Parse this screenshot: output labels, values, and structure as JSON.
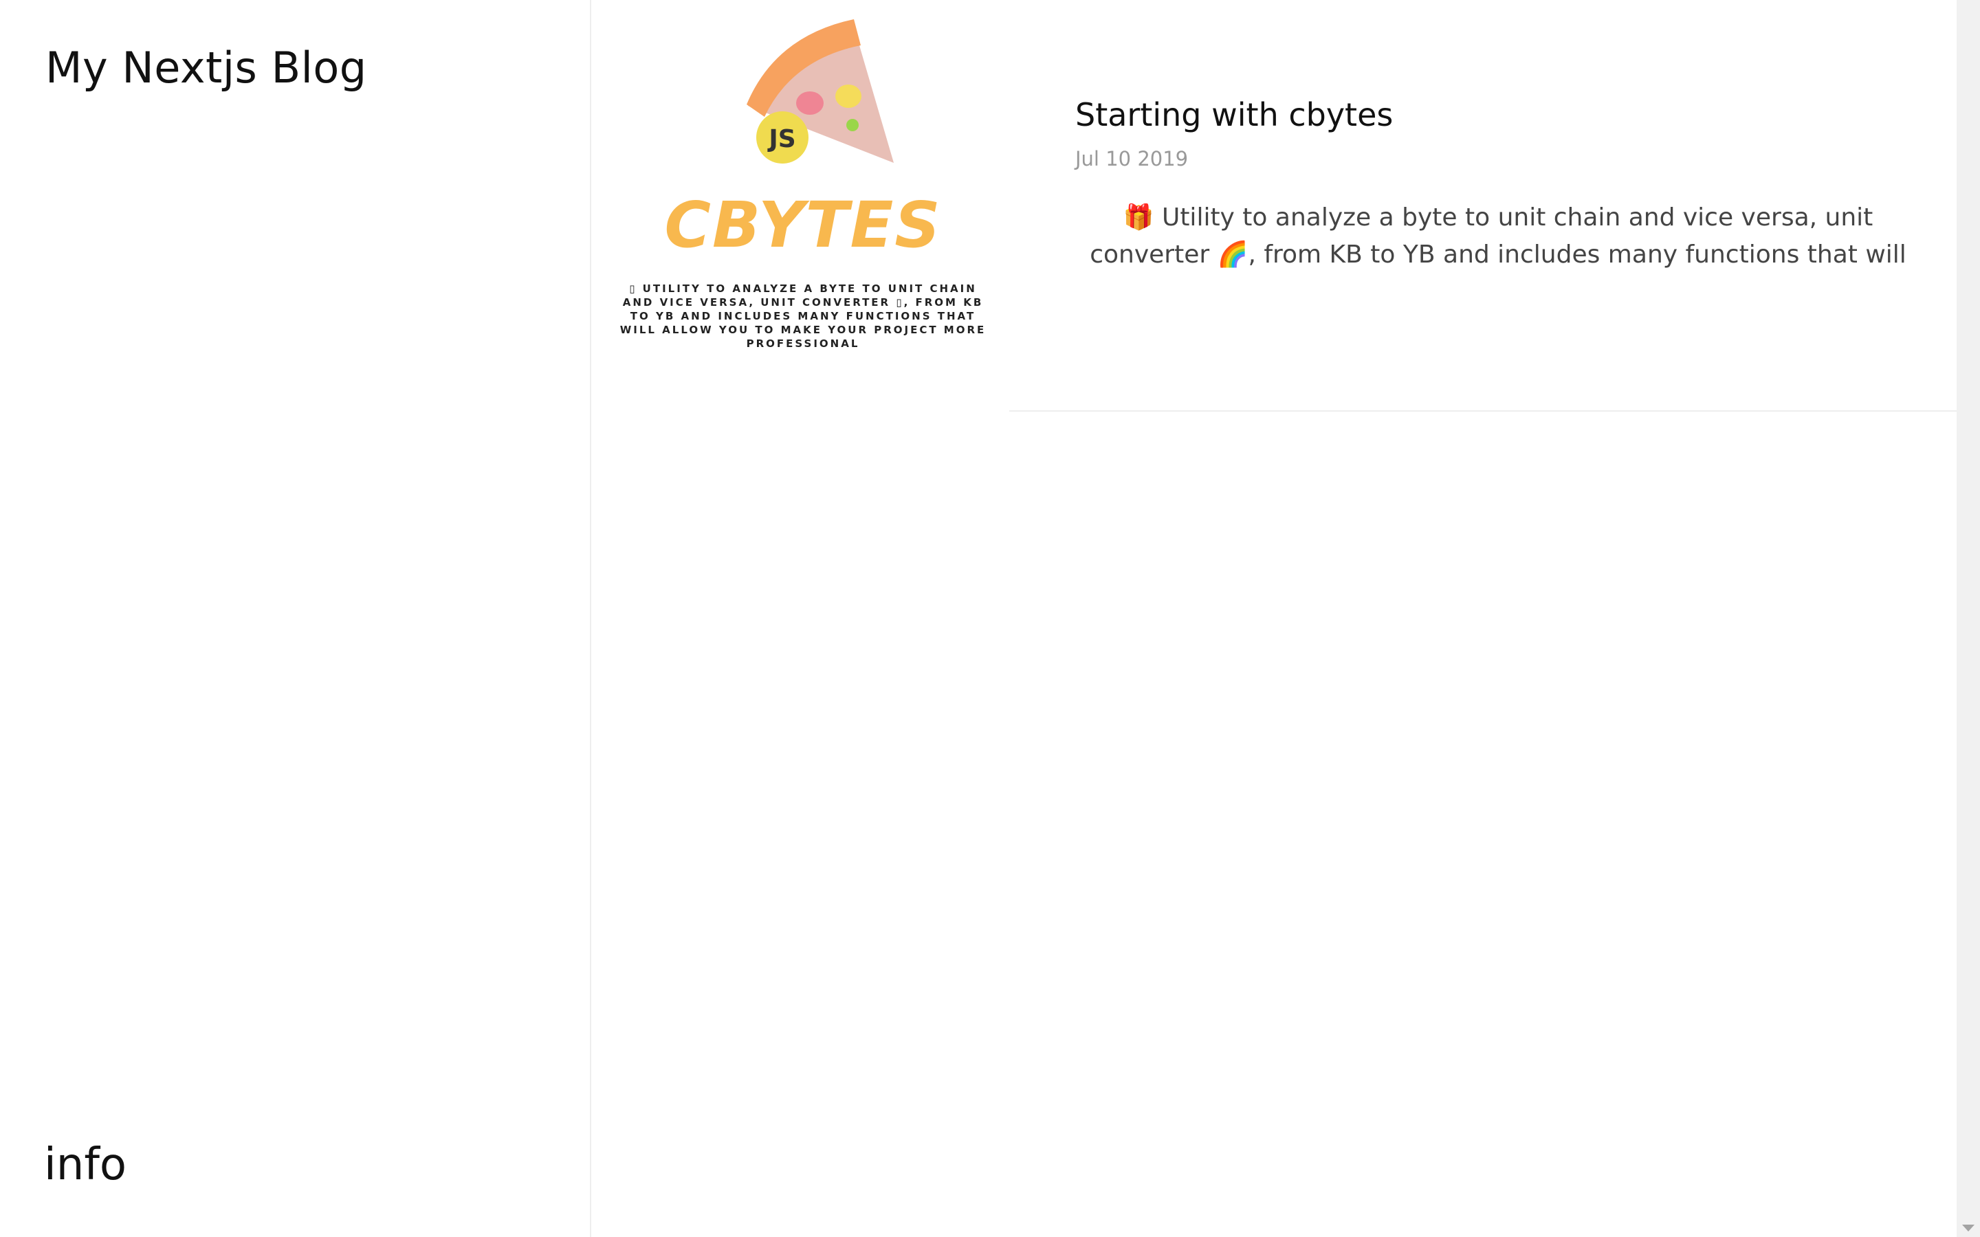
{
  "sidebar": {
    "title": "My Nextjs Blog",
    "info_link": "info"
  },
  "posts": [
    {
      "title": "Starting with cbytes",
      "date": "Jul 10 2019",
      "excerpt": "🎁 Utility to analyze a byte to unit chain and vice versa, unit converter 🌈, from KB to YB and includes many functions that will",
      "thumbnail": {
        "badge": "JS",
        "brand": "CBYTES",
        "tagline": "▯ UTILITY TO ANALYZE A BYTE TO UNIT CHAIN AND VICE VERSA, UNIT CONVERTER ▯, FROM KB TO YB AND INCLUDES MANY FUNCTIONS THAT WILL ALLOW YOU TO MAKE YOUR PROJECT MORE PROFESSIONAL"
      }
    }
  ],
  "colors": {
    "brand_orange": "#f8b84e",
    "badge_yellow": "#f0db4f",
    "divider": "#eeeeee",
    "muted_text": "#999999"
  },
  "icons": {
    "scroll_down": "triangle-down-icon"
  }
}
